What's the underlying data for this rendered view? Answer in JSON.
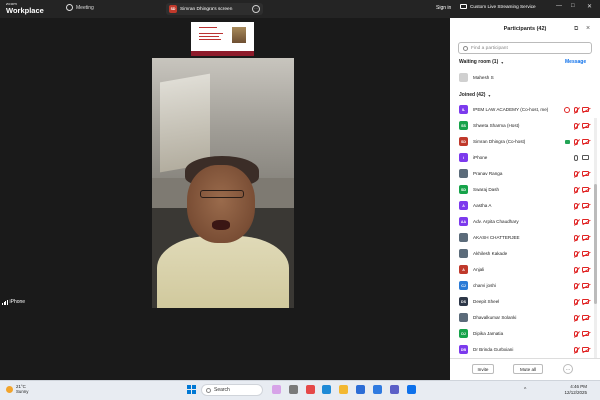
{
  "titlebar": {
    "brand_small": "zoom",
    "brand_large": "Workplace",
    "meeting_label": "Meeting",
    "share_tab": {
      "badge": "SD",
      "label": "Simran Dhingra's screen"
    },
    "signin": "Sign in",
    "livestream": "Custom Live Streaming Service",
    "window_controls": [
      "—",
      "□",
      "✕"
    ]
  },
  "stage": {
    "speaker_name": "iPhone"
  },
  "panel": {
    "title": "Participants (42)",
    "search_placeholder": "Find a participant",
    "waiting_header": "Waiting room (1)",
    "message_link": "Message",
    "waiting": [
      {
        "name": "Mahesh S",
        "initials": "",
        "color": "#d0d0d0"
      }
    ],
    "joined_header": "Joined (42)",
    "joined": [
      {
        "initials": "IL",
        "name": "IPEM LAW ACADEMY (Co-host, me)",
        "color": "#7c3aed",
        "icons": "ring-mic-cam"
      },
      {
        "initials": "SS",
        "name": "Shweta Sharma (Host)",
        "color": "#16a34a",
        "icons": "mic-cam"
      },
      {
        "initials": "SD",
        "name": "Simran Dhingra (Co-host)",
        "color": "#c0392b",
        "icons": "share-mic-cam"
      },
      {
        "initials": "i",
        "name": "iPhone",
        "color": "#7c3aed",
        "icons": "on"
      },
      {
        "initials": "",
        "name": "Pranav Ranga",
        "color": "#5b6b7a",
        "icons": "mic-cam"
      },
      {
        "initials": "SD",
        "name": "Swaraj Dash",
        "color": "#16a34a",
        "icons": "mic-cam"
      },
      {
        "initials": "A",
        "name": "Aastha A",
        "color": "#7c3aed",
        "icons": "mic-cam"
      },
      {
        "initials": "AA",
        "name": "Adv. Arpita Chaudhary",
        "color": "#7c3aed",
        "icons": "mic-cam"
      },
      {
        "initials": "",
        "name": "AKASH CHATTERJEE",
        "color": "#5b6b7a",
        "icons": "mic-cam"
      },
      {
        "initials": "",
        "name": "Akhilesh Kakade",
        "color": "#5b6b7a",
        "icons": "mic-cam"
      },
      {
        "initials": "A",
        "name": "Anjali",
        "color": "#c0392b",
        "icons": "mic-cam"
      },
      {
        "initials": "CJ",
        "name": "charvi joshi",
        "color": "#2b7bd6",
        "icons": "mic-cam"
      },
      {
        "initials": "DS",
        "name": "Deepit Sheel",
        "color": "#2d3748",
        "icons": "mic-cam"
      },
      {
        "initials": "",
        "name": "Dhavalkumar Solanki",
        "color": "#5b6b7a",
        "icons": "mic-cam"
      },
      {
        "initials": "DJ",
        "name": "Dipika Jamatia",
        "color": "#16a34a",
        "icons": "mic-cam"
      },
      {
        "initials": "DB",
        "name": "Dr Brinda Gurbxiani",
        "color": "#7c3aed",
        "icons": "mic-cam"
      }
    ],
    "invite_label": "Invite",
    "mute_all_label": "Mute all",
    "more_label": "···"
  },
  "taskbar": {
    "temperature": "21°C",
    "weather": "Sunny",
    "search_label": "Search",
    "time": "4:46 PM",
    "date": "12/12/2025",
    "tray": "^"
  },
  "colors": {
    "zoom_blue": "#0e71eb",
    "mute_red": "#e02424",
    "panel_bg": "#ffffff",
    "stage_bg": "#1a1a1a"
  }
}
